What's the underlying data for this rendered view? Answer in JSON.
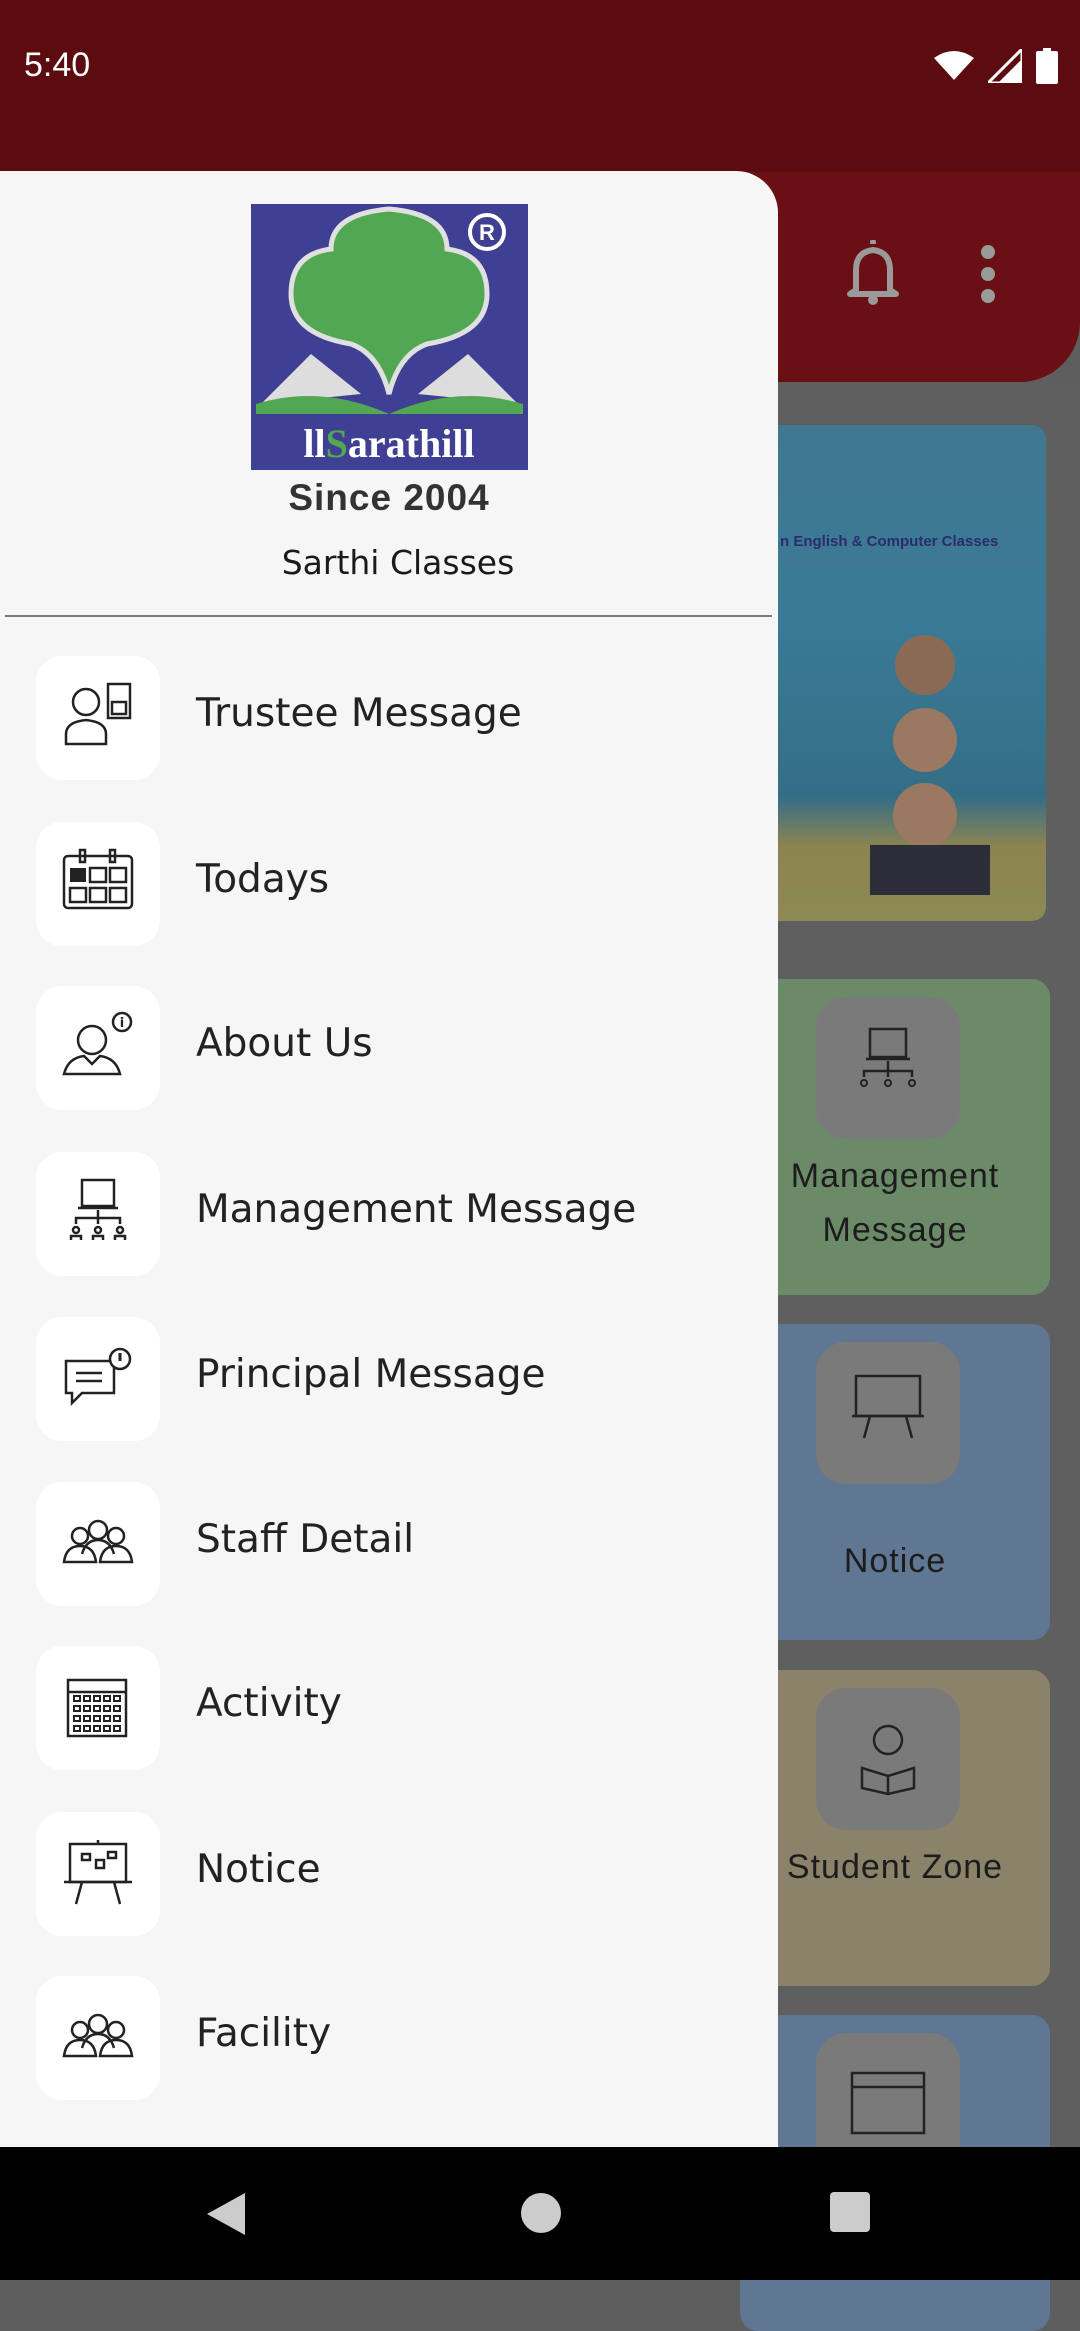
{
  "status_bar": {
    "time": "5:40",
    "icons": [
      "wifi-icon",
      "signal-icon",
      "battery-icon"
    ]
  },
  "header": {
    "icons": [
      "bell-icon",
      "more-vert-icon"
    ],
    "color": "#6a1015"
  },
  "background": {
    "banner_text": "n English & Computer Classes",
    "tiles": [
      {
        "label": "Management Message",
        "icon": "management-icon",
        "color": "#6b8a68"
      },
      {
        "label": "Notice",
        "icon": "notice-board-icon",
        "color": "#5f7792"
      },
      {
        "label": "Student Zone",
        "icon": "student-reading-icon",
        "color": "#8a836a"
      },
      {
        "label": "",
        "icon": "calendar-icon",
        "color": "#5f7792"
      }
    ]
  },
  "drawer": {
    "logo_text": "Sarathi",
    "since": "Since 2004",
    "org_name": "Sarthi Classes",
    "items": [
      {
        "label": "Trustee Message",
        "icon": "trustee-message-icon"
      },
      {
        "label": "Todays",
        "icon": "calendar-today-icon"
      },
      {
        "label": "About Us",
        "icon": "person-info-icon"
      },
      {
        "label": "Management Message",
        "icon": "management-icon"
      },
      {
        "label": "Principal Message",
        "icon": "chat-alert-icon"
      },
      {
        "label": "Staff Detail",
        "icon": "group-icon"
      },
      {
        "label": "Activity",
        "icon": "calendar-grid-icon"
      },
      {
        "label": "Notice",
        "icon": "notice-board-icon"
      },
      {
        "label": "Facility",
        "icon": "group-icon"
      }
    ]
  },
  "nav_bar": {
    "icons": [
      "back-icon",
      "home-icon",
      "recents-icon"
    ]
  }
}
